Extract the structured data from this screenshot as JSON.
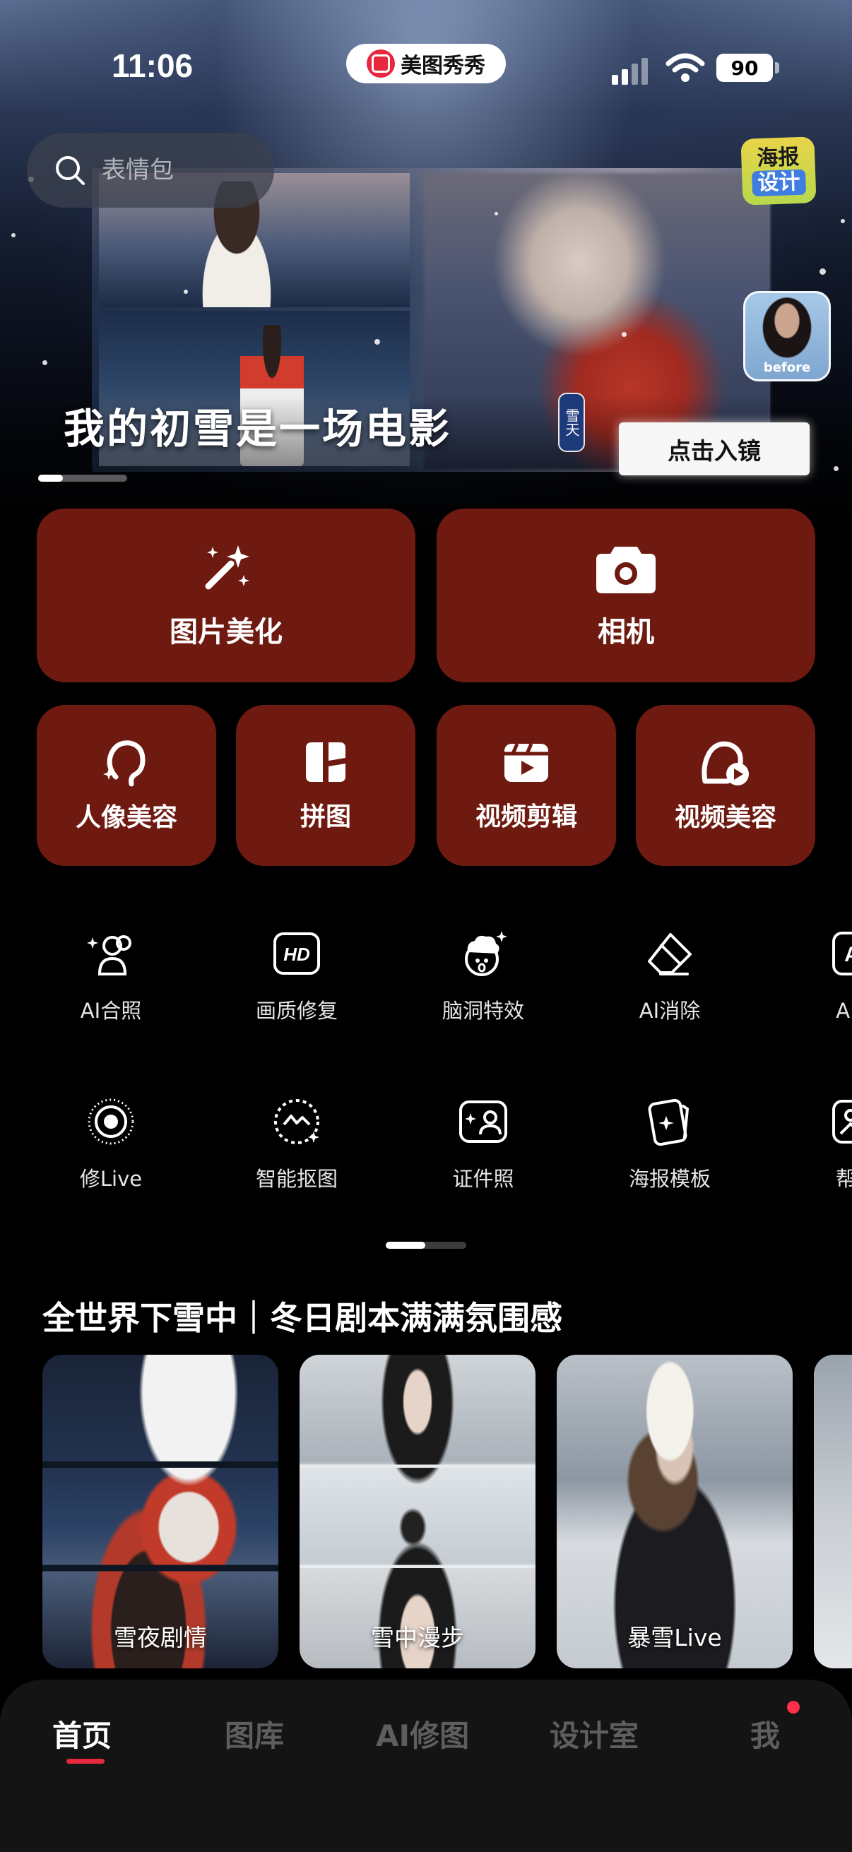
{
  "status_bar": {
    "time": "11:06",
    "battery": "90"
  },
  "app_pill": {
    "name": "美图秀秀"
  },
  "search": {
    "placeholder": "表情包"
  },
  "hero": {
    "title": "我的初雪是一场电影",
    "seal": "雪天",
    "cta": "点击入镜",
    "badge_line1": "海报",
    "badge_line2": "设计",
    "before_label": "before",
    "progress": 0.28
  },
  "primary_cards": [
    {
      "label": "图片美化",
      "icon": "magic-wand-icon"
    },
    {
      "label": "相机",
      "icon": "camera-icon"
    }
  ],
  "secondary_cards": [
    {
      "label": "人像美容",
      "icon": "portrait-icon"
    },
    {
      "label": "拼图",
      "icon": "collage-icon"
    },
    {
      "label": "视频剪辑",
      "icon": "video-edit-icon"
    },
    {
      "label": "视频美容",
      "icon": "video-beauty-icon"
    }
  ],
  "tools_row1": [
    {
      "label": "AI合照",
      "icon": "ai-group-photo-icon"
    },
    {
      "label": "画质修复",
      "icon": "hd-icon"
    },
    {
      "label": "脑洞特效",
      "icon": "brain-effect-icon"
    },
    {
      "label": "AI消除",
      "icon": "eraser-icon"
    },
    {
      "label": "AI写",
      "icon": "ai-write-icon"
    }
  ],
  "tools_row2": [
    {
      "label": "修Live",
      "icon": "live-icon"
    },
    {
      "label": "智能抠图",
      "icon": "cutout-icon"
    },
    {
      "label": "证件照",
      "icon": "id-photo-icon"
    },
    {
      "label": "海报模板",
      "icon": "poster-template-icon"
    },
    {
      "label": "帮我",
      "icon": "help-me-icon"
    }
  ],
  "section": {
    "title": "全世界下雪中｜冬日剧本满满氛围感",
    "cards": [
      {
        "caption": "雪夜剧情"
      },
      {
        "caption": "雪中漫步"
      },
      {
        "caption": "暴雪Live"
      },
      {
        "caption": ""
      }
    ]
  },
  "tabs": [
    {
      "label": "首页",
      "active": true
    },
    {
      "label": "图库",
      "active": false
    },
    {
      "label": "AI修图",
      "active": false
    },
    {
      "label": "设计室",
      "active": false
    },
    {
      "label": "我",
      "active": false
    }
  ],
  "colors": {
    "card_bg": "#6f1a10",
    "accent_red": "#e8283f",
    "tabbar_bg": "#141414"
  }
}
